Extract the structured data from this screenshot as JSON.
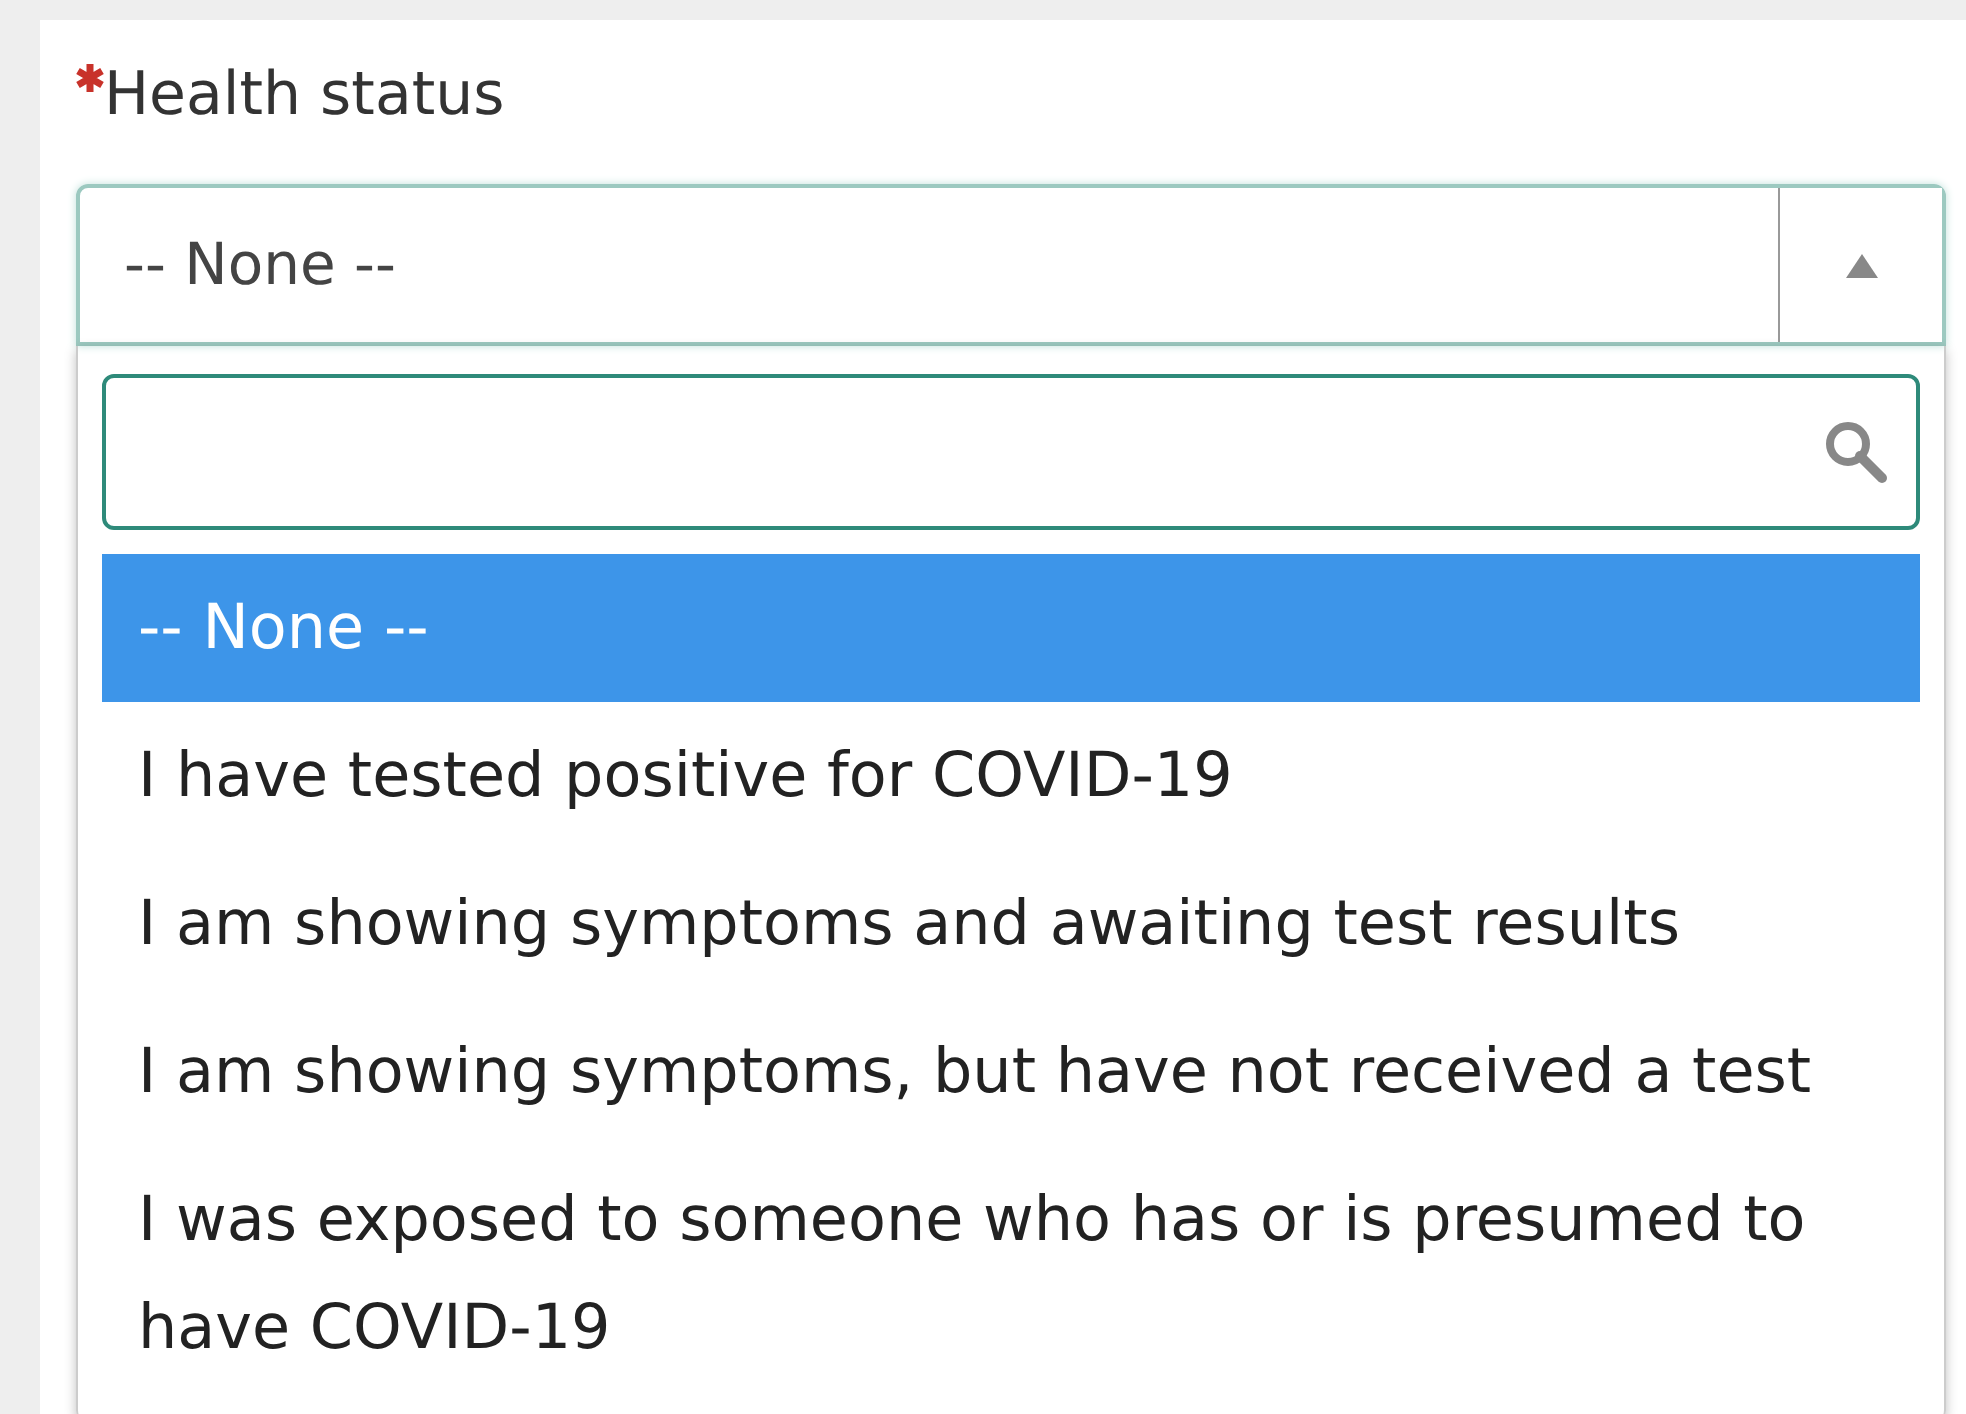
{
  "field": {
    "label": "Health status",
    "required": true,
    "value": "-- None --",
    "expanded": true
  },
  "options": [
    {
      "label": "-- None --",
      "selected": true
    },
    {
      "label": "I have tested positive for COVID-19",
      "selected": false
    },
    {
      "label": "I am showing symptoms and awaiting test results",
      "selected": false
    },
    {
      "label": "I am showing symptoms, but have not received a test",
      "selected": false
    },
    {
      "label": "I was exposed to someone who has or is presumed to have COVID-19",
      "selected": false
    }
  ]
}
